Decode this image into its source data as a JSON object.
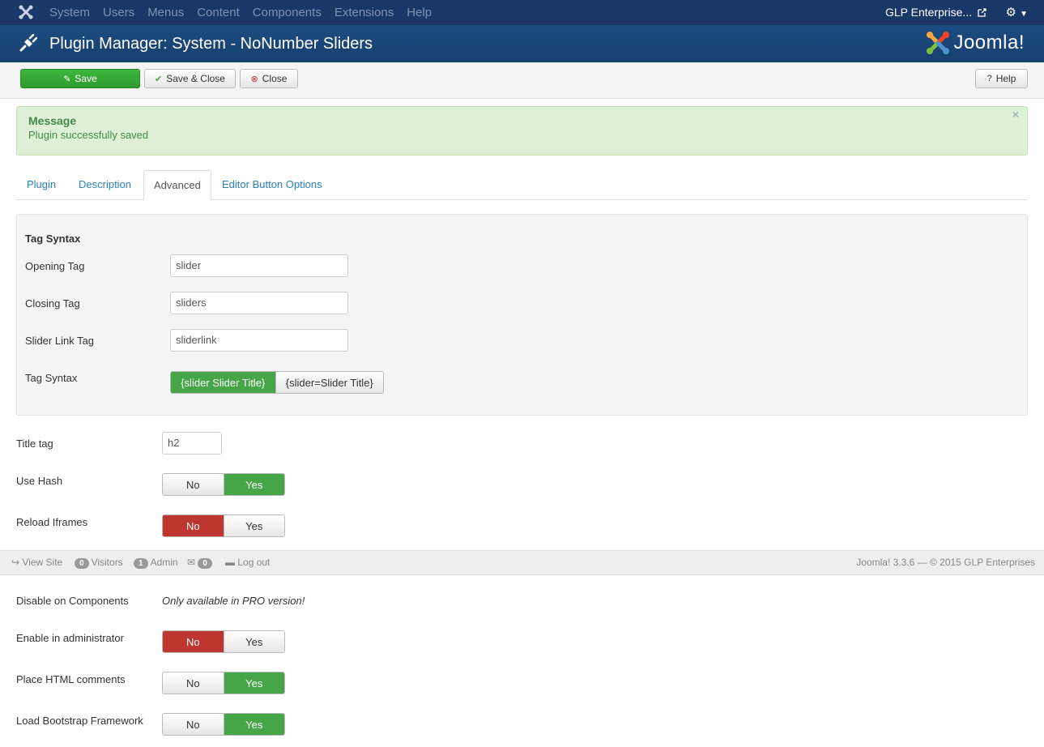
{
  "topnav": {
    "menu": [
      "System",
      "Users",
      "Menus",
      "Content",
      "Components",
      "Extensions",
      "Help"
    ],
    "site_name": "GLP Enterprise...",
    "icons": [
      "joomla-logo-icon",
      "external-link-icon",
      "gear-icon",
      "caret-down-icon"
    ]
  },
  "header": {
    "title": "Plugin Manager: System - NoNumber Sliders",
    "brand": "Joomla!"
  },
  "toolbar": {
    "save_label": "Save",
    "save_close_label": "Save & Close",
    "close_label": "Close",
    "help_label": "Help"
  },
  "message": {
    "heading": "Message",
    "text": "Plugin successfully saved",
    "close": "×"
  },
  "tabs": [
    "Plugin",
    "Description",
    "Advanced",
    "Editor Button Options"
  ],
  "tag_syntax": {
    "legend": "Tag Syntax",
    "opening_tag": {
      "label": "Opening Tag",
      "value": "slider"
    },
    "closing_tag": {
      "label": "Closing Tag",
      "value": "sliders"
    },
    "slider_link_tag": {
      "label": "Slider Link Tag",
      "value": "sliderlink"
    },
    "syntax": {
      "label": "Tag Syntax",
      "options": [
        "{slider Slider Title}",
        "{slider=Slider Title}"
      ],
      "selected": "{slider Slider Title}"
    }
  },
  "fields": {
    "title_tag": {
      "label": "Title tag",
      "value": "h2"
    },
    "use_hash": {
      "label": "Use Hash",
      "no": "No",
      "yes": "Yes",
      "selected": "Yes"
    },
    "reload_iframes": {
      "label": "Reload Iframes",
      "no": "No",
      "yes": "Yes",
      "selected": "No"
    },
    "disable_on_components": {
      "label": "Disable on Components",
      "value": "Only available in PRO version!"
    },
    "enable_in_admin": {
      "label": "Enable in administrator",
      "no": "No",
      "yes": "Yes",
      "selected": "No"
    },
    "html_comments": {
      "label": "Place HTML comments",
      "no": "No",
      "yes": "Yes",
      "selected": "Yes"
    },
    "load_bootstrap": {
      "label": "Load Bootstrap Framework",
      "no": "No",
      "yes": "Yes",
      "selected": "Yes"
    }
  },
  "statusbar": {
    "view_site": "View Site",
    "visitors_count": "0",
    "visitors": "Visitors",
    "admin_count": "1",
    "admin": "Admin",
    "messages_count": "0",
    "logout": "Log out",
    "footer": "Joomla! 3.3.6 — © 2015 GLP Enterprises"
  },
  "colors": {
    "nav": "#1a3867",
    "header": "#1d4b80",
    "success": "#46a546",
    "danger": "#bd362f",
    "link": "#2a7fb8"
  }
}
